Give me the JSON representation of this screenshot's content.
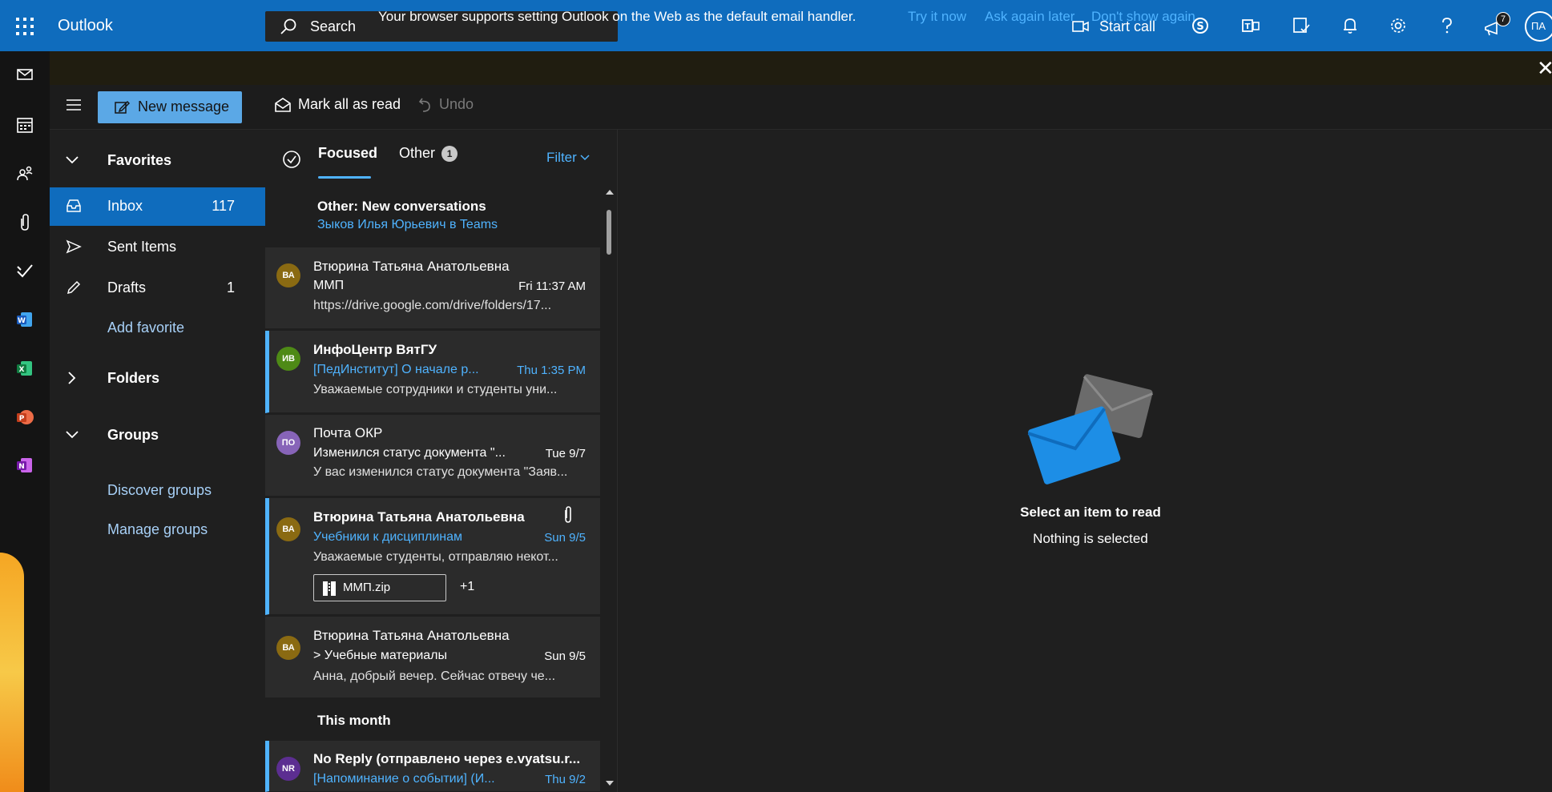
{
  "topbar": {
    "app_title": "Outlook",
    "search_placeholder": "Search",
    "start_call": "Start call",
    "notification_count": "7",
    "user_initials": "ПА",
    "icons": [
      "waffle-icon",
      "video-icon",
      "skype-icon",
      "teams-icon",
      "todo-icon",
      "bell-icon",
      "gear-icon",
      "help-icon",
      "feedback-icon"
    ]
  },
  "rail": {
    "items": [
      "mail-icon",
      "calendar-icon",
      "people-icon",
      "attach-icon",
      "todo-icon",
      "word-icon",
      "excel-icon",
      "powerpoint-icon",
      "onenote-icon"
    ]
  },
  "banner": {
    "text": "Your browser supports setting Outlook on the Web as the default email handler.",
    "try_now": "Try it now",
    "ask_later": "Ask again later",
    "dont_show": "Don't show again"
  },
  "commands": {
    "new_message": "New message",
    "mark_all_read": "Mark all as read",
    "undo": "Undo"
  },
  "folders": {
    "favorites": "Favorites",
    "inbox": "Inbox",
    "inbox_count": "117",
    "sent": "Sent Items",
    "drafts": "Drafts",
    "drafts_count": "1",
    "add_favorite": "Add favorite",
    "folders": "Folders",
    "groups": "Groups",
    "discover_groups": "Discover groups",
    "manage_groups": "Manage groups"
  },
  "list": {
    "tab_focused": "Focused",
    "tab_other": "Other",
    "other_count": "1",
    "filter": "Filter",
    "this_month": "This month",
    "notice": {
      "title": "Other: New conversations",
      "line": "Зыков Илья Юрьевич в Teams"
    },
    "messages": [
      {
        "initials": "ВА",
        "sender": "Втюрина Татьяна Анатольевна",
        "subject": "ММП",
        "time": "Fri 11:37 AM",
        "preview": "https://drive.google.com/drive/folders/17...",
        "color": "#8a6a12"
      },
      {
        "initials": "ИВ",
        "sender": "ИнфоЦентр ВятГУ",
        "subject": "[ПедИнститут] О начале р...",
        "time": "Thu 1:35 PM",
        "preview": "Уважаемые сотрудники и студенты уни...",
        "color": "#4e8a16"
      },
      {
        "initials": "ПО",
        "sender": "Почта ОКР",
        "subject": "Изменился статус документа \"...",
        "time": "Tue 9/7",
        "preview": "У вас изменился статус документа \"Заяв...",
        "color": "#8764b8"
      },
      {
        "initials": "ВА",
        "sender": "Втюрина Татьяна Анатольевна",
        "subject": "Учебники к дисциплинам",
        "time": "Sun 9/5",
        "preview": "Уважаемые студенты, отправляю некот...",
        "color": "#8a6a12",
        "attachment": "ММП.zip",
        "attachment_more": "+1"
      },
      {
        "initials": "ВА",
        "sender": "Втюрина Татьяна Анатольевна",
        "subject": "> Учебные материалы",
        "time": "Sun 9/5",
        "preview": "Анна, добрый вечер. Сейчас отвечу че...",
        "color": "#8a6a12"
      },
      {
        "initials": "NR",
        "sender": "No Reply (отправлено через e.vyatsu.r...",
        "subject": "[Напоминание о событии] (И...",
        "time": "Thu 9/2",
        "preview": "",
        "color": "#5c2e91"
      }
    ]
  },
  "reading": {
    "title": "Select an item to read",
    "subtitle": "Nothing is selected"
  }
}
